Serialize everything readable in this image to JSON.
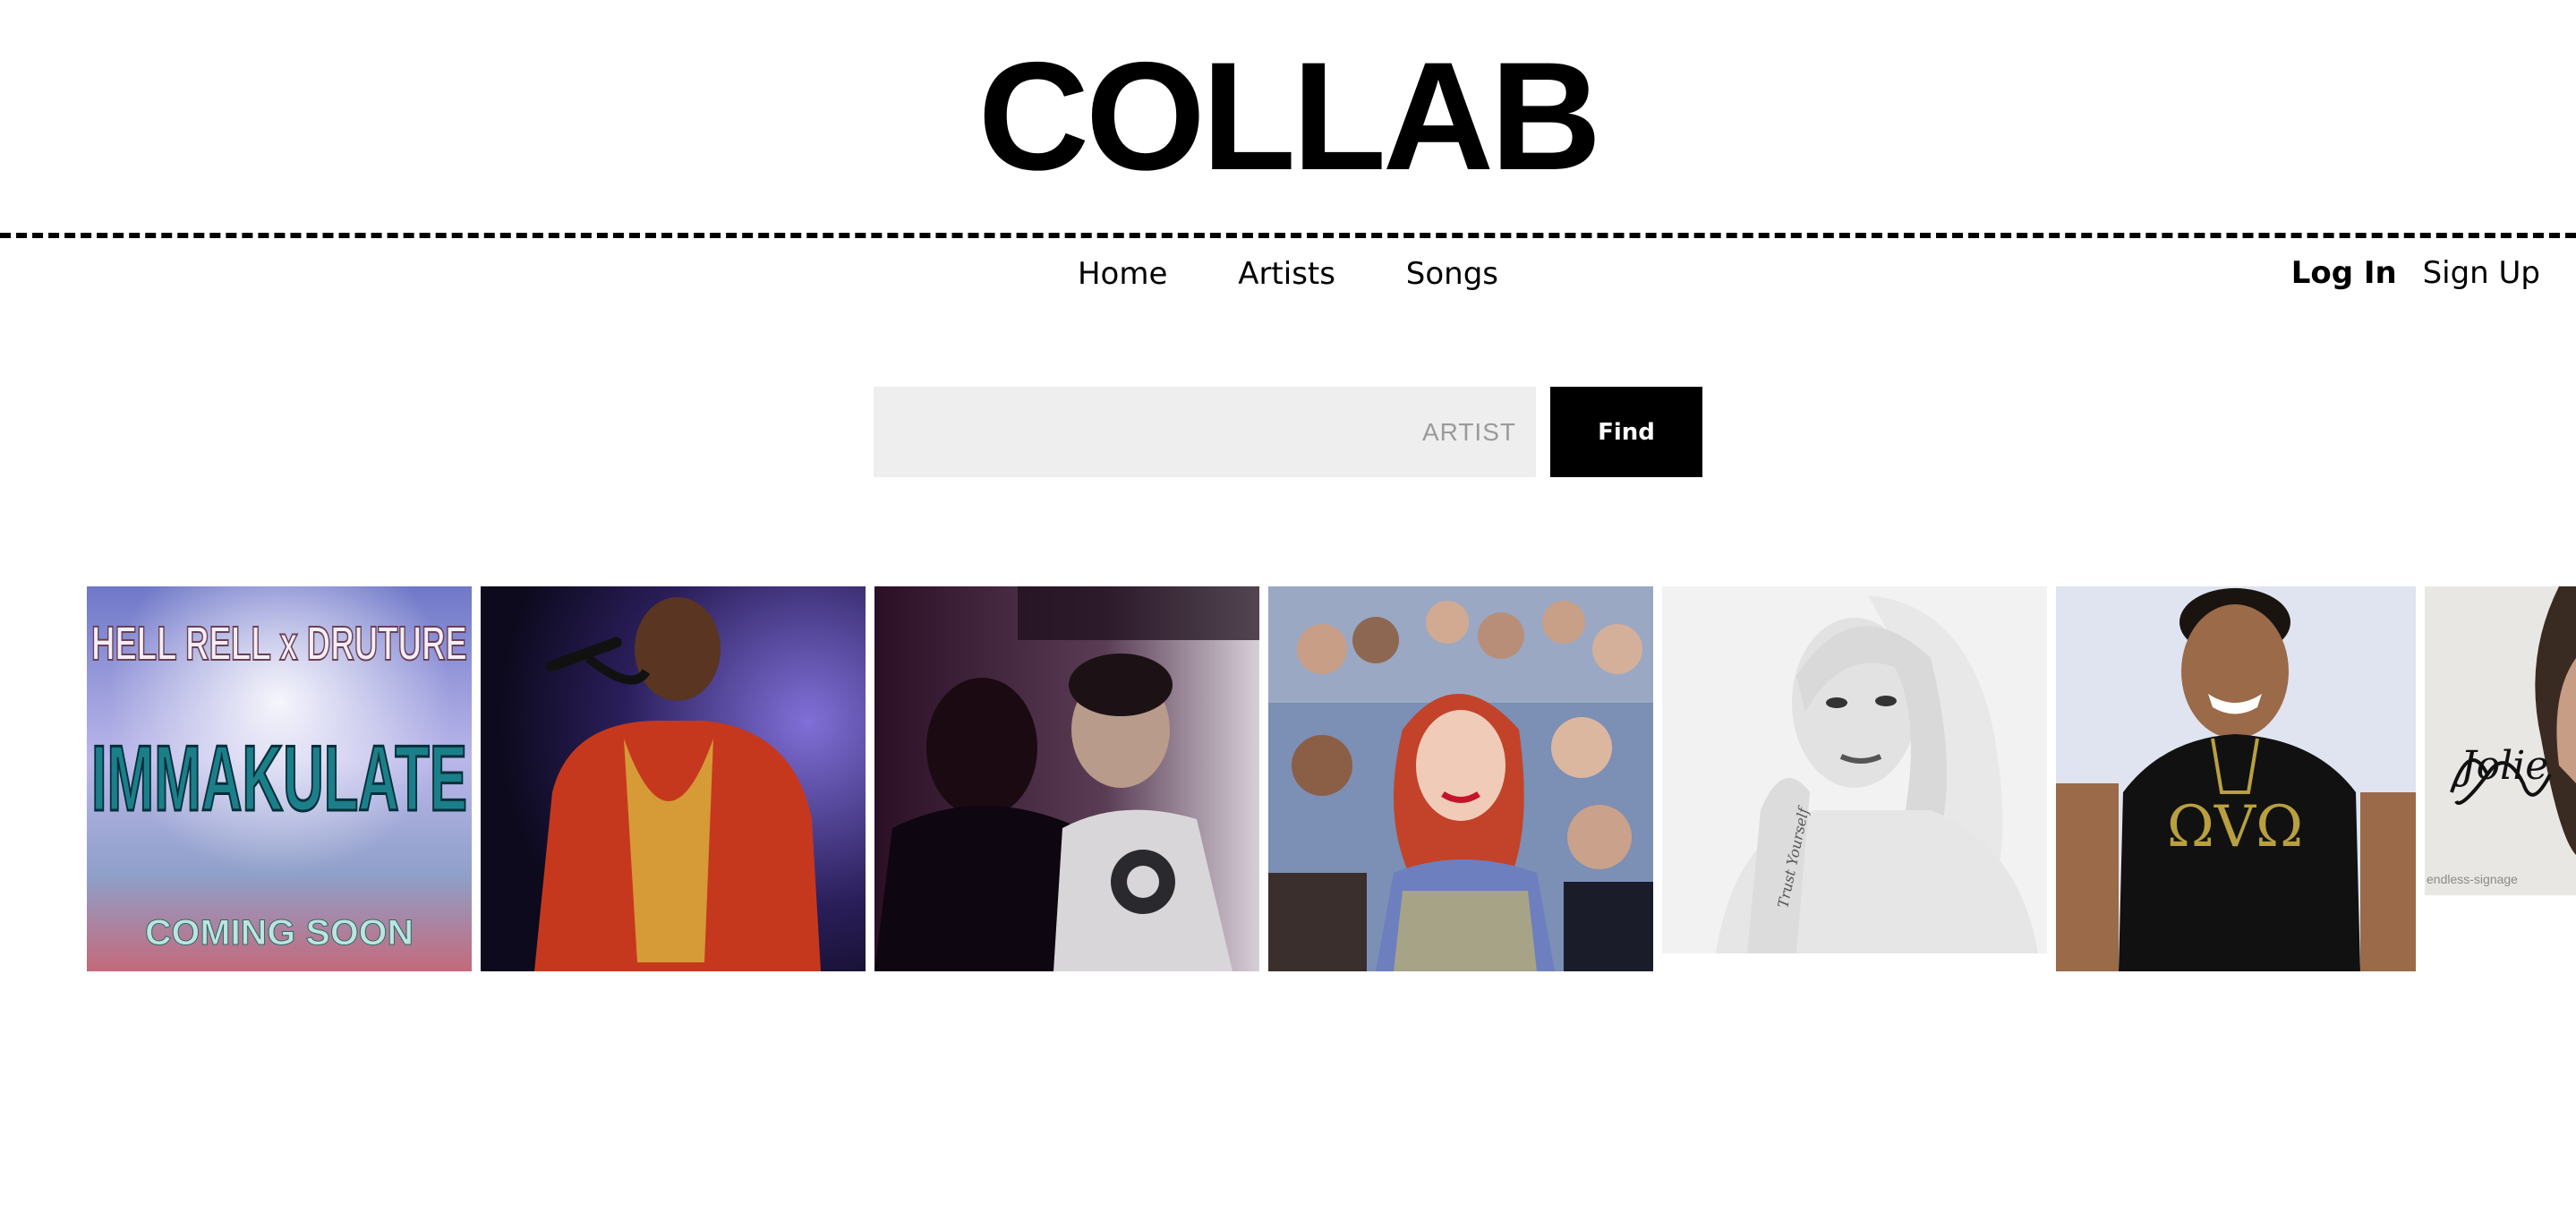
{
  "site": {
    "logo": "COLLAB"
  },
  "nav": {
    "items": [
      "Home",
      "Artists",
      "Songs"
    ]
  },
  "auth": {
    "login": "Log In",
    "signup": "Sign Up"
  },
  "search": {
    "placeholder": "ARTIST",
    "value": "",
    "button_label": "Find"
  },
  "gallery": {
    "tile1": {
      "line1": "HELL RELL x DRUTURE",
      "line2": "IMMAKULATE",
      "line3": "COMING SOON"
    },
    "tile7": {
      "signature": "Jolie",
      "caption": "endless-signage"
    },
    "tile5": {
      "tattoo": "Trust Yourself"
    }
  },
  "colors": {
    "accent": "#000000",
    "input_bg": "#eeeeee",
    "placeholder": "#9a9a9a"
  }
}
